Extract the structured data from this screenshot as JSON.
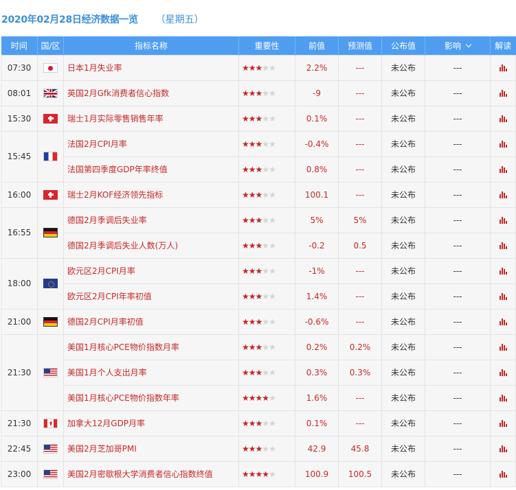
{
  "header": {
    "date_title": "2020年02月28日经济数据一览",
    "weekday": "（星期五）"
  },
  "columns": {
    "time": "时间",
    "region": "国/区",
    "indicator": "指标名称",
    "importance": "重要性",
    "previous": "前值",
    "forecast": "预测值",
    "actual": "公布值",
    "impact": "影响",
    "analysis": "解读"
  },
  "colors": {
    "header_bg": "#4f9df0",
    "title": "#3b8fd8",
    "accent_red": "#c42525",
    "row_bg": "#f6f6f6"
  },
  "groups": [
    {
      "time": "07:30",
      "flag": "jp-flag-icon",
      "items": [
        {
          "name": "日本1月失业率",
          "stars": 3,
          "previous": "2.2%",
          "forecast": "---",
          "actual": "未公布",
          "impact": "---"
        }
      ]
    },
    {
      "time": "08:01",
      "flag": "uk-flag-icon",
      "items": [
        {
          "name": "英国2月Gfk消费者信心指数",
          "stars": 3,
          "previous": "-9",
          "forecast": "---",
          "actual": "未公布",
          "impact": "---"
        }
      ]
    },
    {
      "time": "15:30",
      "flag": "ch-flag-icon",
      "items": [
        {
          "name": "瑞士1月实际零售销售年率",
          "stars": 3,
          "previous": "0.1%",
          "forecast": "---",
          "actual": "未公布",
          "impact": "---"
        }
      ]
    },
    {
      "time": "15:45",
      "flag": "fr-flag-icon",
      "items": [
        {
          "name": "法国2月CPI月率",
          "stars": 3,
          "previous": "-0.4%",
          "forecast": "---",
          "actual": "未公布",
          "impact": "---"
        },
        {
          "name": "法国第四季度GDP年率终值",
          "stars": 3,
          "previous": "0.8%",
          "forecast": "---",
          "actual": "未公布",
          "impact": "---"
        }
      ]
    },
    {
      "time": "16:00",
      "flag": "ch-flag-icon",
      "items": [
        {
          "name": "瑞士2月KOF经济领先指标",
          "stars": 3,
          "previous": "100.1",
          "forecast": "---",
          "actual": "未公布",
          "impact": "---"
        }
      ]
    },
    {
      "time": "16:55",
      "flag": "de-flag-icon",
      "items": [
        {
          "name": "德国2月季调后失业率",
          "stars": 3,
          "previous": "5%",
          "forecast": "5%",
          "actual": "未公布",
          "impact": "---"
        },
        {
          "name": "德国2月季调后失业人数(万人)",
          "stars": 3,
          "previous": "-0.2",
          "forecast": "0.5",
          "actual": "未公布",
          "impact": "---"
        }
      ]
    },
    {
      "time": "18:00",
      "flag": "eu-flag-icon",
      "items": [
        {
          "name": "欧元区2月CPI月率",
          "stars": 3,
          "previous": "-1%",
          "forecast": "---",
          "actual": "未公布",
          "impact": "---"
        },
        {
          "name": "欧元区2月CPI年率初值",
          "stars": 3,
          "previous": "1.4%",
          "forecast": "---",
          "actual": "未公布",
          "impact": "---"
        }
      ]
    },
    {
      "time": "21:00",
      "flag": "de-flag-icon",
      "items": [
        {
          "name": "德国2月CPI月率初值",
          "stars": 3,
          "previous": "-0.6%",
          "forecast": "---",
          "actual": "未公布",
          "impact": "---"
        }
      ]
    },
    {
      "time": "21:30",
      "flag": "us-flag-icon",
      "items": [
        {
          "name": "美国1月核心PCE物价指数月率",
          "stars": 3,
          "previous": "0.2%",
          "forecast": "0.2%",
          "actual": "未公布",
          "impact": "---"
        },
        {
          "name": "美国1月个人支出月率",
          "stars": 3,
          "previous": "0.3%",
          "forecast": "0.3%",
          "actual": "未公布",
          "impact": "---"
        },
        {
          "name": "美国1月核心PCE物价指数年率",
          "stars": 4,
          "previous": "1.6%",
          "forecast": "---",
          "actual": "未公布",
          "impact": "---"
        }
      ]
    },
    {
      "time": "21:30",
      "flag": "ca-flag-icon",
      "items": [
        {
          "name": "加拿大12月GDP月率",
          "stars": 3,
          "previous": "0.1%",
          "forecast": "---",
          "actual": "未公布",
          "impact": "---"
        }
      ]
    },
    {
      "time": "22:45",
      "flag": "us-flag-icon",
      "items": [
        {
          "name": "美国2月芝加哥PMI",
          "stars": 3,
          "previous": "42.9",
          "forecast": "45.8",
          "actual": "未公布",
          "impact": "---"
        }
      ]
    },
    {
      "time": "23:00",
      "flag": "us-flag-icon",
      "items": [
        {
          "name": "美国2月密歇根大学消费者信心指数终值",
          "stars": 4,
          "previous": "100.9",
          "forecast": "100.5",
          "actual": "未公布",
          "impact": "---"
        }
      ]
    }
  ]
}
